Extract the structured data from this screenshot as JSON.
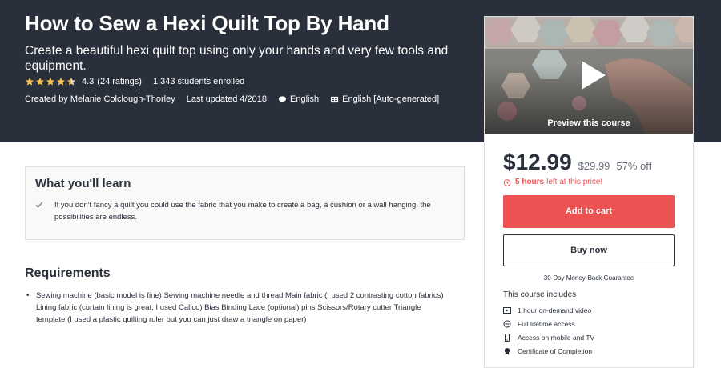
{
  "course": {
    "title": "How to Sew a Hexi Quilt Top By Hand",
    "subtitle": "Create a beautiful hexi quilt top using only your hands and very few tools and equipment.",
    "rating": "4.3",
    "rating_value": 4.3,
    "rating_max": 5,
    "ratings_count": "(24 ratings)",
    "students": "1,343 students enrolled",
    "created_by": "Created by Melanie Colclough-Thorley",
    "last_updated": "Last updated 4/2018",
    "language": "English",
    "captions": "English [Auto-generated]"
  },
  "sidebar": {
    "preview_label": "Preview this course",
    "price": "$12.99",
    "old_price": "$29.99",
    "discount": "57% off",
    "timer_bold": "5 hours",
    "timer_rest": "left at this price!",
    "add_to_cart": "Add to cart",
    "buy_now": "Buy now",
    "guarantee": "30-Day Money-Back Guarantee",
    "includes_title": "This course includes",
    "includes": [
      {
        "icon": "video-icon",
        "label": "1 hour on-demand video"
      },
      {
        "icon": "infinity-icon",
        "label": "Full lifetime access"
      },
      {
        "icon": "mobile-icon",
        "label": "Access on mobile and TV"
      },
      {
        "icon": "certificate-icon",
        "label": "Certificate of Completion"
      }
    ]
  },
  "learn": {
    "title": "What you'll learn",
    "items": [
      "If you don't fancy a quilt you could use the fabric that you make to create a bag, a cushion or a wall hanging, the possibilities are endless."
    ]
  },
  "requirements": {
    "title": "Requirements",
    "items": [
      "Sewing machine (basic model is fine) Sewing machine needle and thread Main fabric (I used 2 contrasting cotton fabrics) Lining fabric (curtain lining is great, I used Calico) Bias Binding Lace (optional) pins Scissors/Rotary cutter Triangle template (I used a plastic quilting ruler but you can just draw a triangle on paper)"
    ]
  },
  "colors": {
    "hero_bg": "#29303b",
    "accent": "#ec5252",
    "star": "#f4c150"
  }
}
